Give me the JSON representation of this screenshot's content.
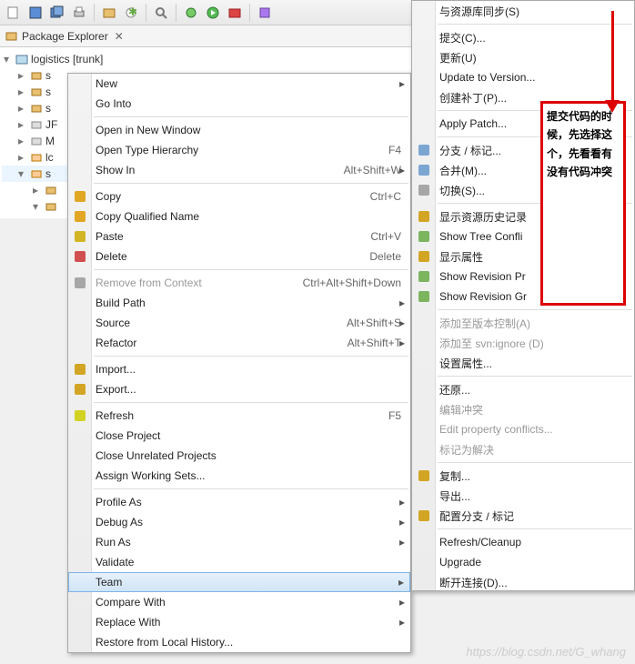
{
  "toolbar_icons": [
    "save",
    "save-all",
    "print",
    "new-dropdown",
    "sep",
    "package",
    "class",
    "sep",
    "search",
    "debug",
    "run",
    "external",
    "sep",
    "new-class",
    "open-type",
    "dropdown"
  ],
  "package_explorer": {
    "title": "Package Explorer",
    "close_x": "✕"
  },
  "tree": {
    "root": "logistics [trunk]",
    "children": [
      "s",
      "s",
      "s",
      "JF",
      "M",
      "lc",
      "s",
      "",
      "",
      ""
    ]
  },
  "menu1": [
    {
      "label": "New",
      "arrow": true
    },
    {
      "label": "Go Into"
    },
    {
      "sep": true
    },
    {
      "label": "Open in New Window"
    },
    {
      "label": "Open Type Hierarchy",
      "shortcut": "F4"
    },
    {
      "label": "Show In",
      "shortcut": "Alt+Shift+W",
      "arrow": true
    },
    {
      "sep": true
    },
    {
      "label": "Copy",
      "shortcut": "Ctrl+C",
      "icon": "copy"
    },
    {
      "label": "Copy Qualified Name",
      "icon": "copy-q"
    },
    {
      "label": "Paste",
      "shortcut": "Ctrl+V",
      "icon": "paste"
    },
    {
      "label": "Delete",
      "shortcut": "Delete",
      "icon": "delete"
    },
    {
      "sep": true
    },
    {
      "label": "Remove from Context",
      "shortcut": "Ctrl+Alt+Shift+Down",
      "disabled": true,
      "icon": "remove"
    },
    {
      "label": "Build Path",
      "arrow": true
    },
    {
      "label": "Source",
      "shortcut": "Alt+Shift+S",
      "arrow": true
    },
    {
      "label": "Refactor",
      "shortcut": "Alt+Shift+T",
      "arrow": true
    },
    {
      "sep": true
    },
    {
      "label": "Import...",
      "icon": "import"
    },
    {
      "label": "Export...",
      "icon": "export"
    },
    {
      "sep": true
    },
    {
      "label": "Refresh",
      "shortcut": "F5",
      "icon": "refresh"
    },
    {
      "label": "Close Project"
    },
    {
      "label": "Close Unrelated Projects"
    },
    {
      "label": "Assign Working Sets..."
    },
    {
      "sep": true
    },
    {
      "label": "Profile As",
      "arrow": true
    },
    {
      "label": "Debug As",
      "arrow": true
    },
    {
      "label": "Run As",
      "arrow": true
    },
    {
      "label": "Validate"
    },
    {
      "label": "Team",
      "arrow": true,
      "hover": true
    },
    {
      "label": "Compare With",
      "arrow": true
    },
    {
      "label": "Replace With",
      "arrow": true
    },
    {
      "label": "Restore from Local History..."
    }
  ],
  "menu2": [
    {
      "label": "与资源库同步(S)"
    },
    {
      "sep": true
    },
    {
      "label": "提交(C)..."
    },
    {
      "label": "更新(U)"
    },
    {
      "label": "Update to Version..."
    },
    {
      "label": "创建补丁(P)..."
    },
    {
      "sep": true
    },
    {
      "label": "Apply Patch..."
    },
    {
      "sep": true
    },
    {
      "label": "分支 / 标记...",
      "icon": "branch"
    },
    {
      "label": "合并(M)...",
      "icon": "merge"
    },
    {
      "label": "切换(S)...",
      "icon": "switch"
    },
    {
      "sep": true
    },
    {
      "label": "显示资源历史记录",
      "icon": "history"
    },
    {
      "label": "Show Tree Confli",
      "icon": "tree"
    },
    {
      "label": "显示属性",
      "icon": "props"
    },
    {
      "label": "Show Revision Pr",
      "icon": "revp"
    },
    {
      "label": "Show Revision Gr",
      "icon": "revg"
    },
    {
      "sep": true
    },
    {
      "label": "添加至版本控制(A)",
      "disabled": true
    },
    {
      "label": "添加至 svn:ignore (D)",
      "disabled": true
    },
    {
      "label": "设置属性..."
    },
    {
      "sep": true
    },
    {
      "label": "还原..."
    },
    {
      "label": "编辑冲突",
      "disabled": true
    },
    {
      "label": "Edit property conflicts...",
      "disabled": true
    },
    {
      "label": "标记为解决",
      "disabled": true
    },
    {
      "sep": true
    },
    {
      "label": "复制...",
      "icon": "copy2"
    },
    {
      "label": "导出..."
    },
    {
      "label": "配置分支 / 标记",
      "icon": "config"
    },
    {
      "sep": true
    },
    {
      "label": "Refresh/Cleanup"
    },
    {
      "label": "Upgrade"
    },
    {
      "label": "断开连接(D)..."
    }
  ],
  "callout_text": "提交代码的时候，先选择这个，先看看有没有代码冲突",
  "watermark": "https://blog.csdn.net/G_whang"
}
